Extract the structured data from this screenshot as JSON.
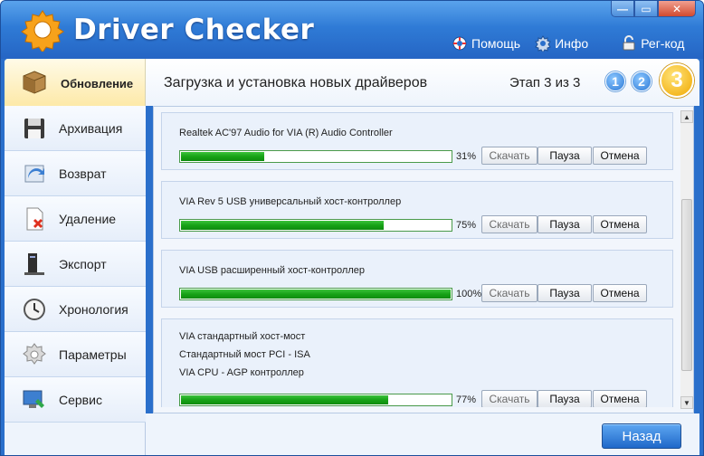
{
  "app": {
    "title": "Driver Checker"
  },
  "window_controls": {
    "minimize": "—",
    "restore": "▭",
    "close": "✕"
  },
  "top_links": [
    {
      "label": "Помощь",
      "icon": "help-icon"
    },
    {
      "label": "Инфо",
      "icon": "info-gear-icon"
    },
    {
      "label": "Рег-код",
      "icon": "lock-icon"
    }
  ],
  "header": {
    "active_tab": "Обновление",
    "title": "Загрузка и установка новых драйверов",
    "stage": "Этап 3 из 3",
    "steps": [
      "1",
      "2",
      "3"
    ]
  },
  "sidebar": {
    "items": [
      {
        "label": "Архивация",
        "icon": "floppy-disk-icon"
      },
      {
        "label": "Возврат",
        "icon": "restore-arrow-icon"
      },
      {
        "label": "Удаление",
        "icon": "delete-document-icon"
      },
      {
        "label": "Экспорт",
        "icon": "export-icon"
      },
      {
        "label": "Хронология",
        "icon": "clock-icon"
      },
      {
        "label": "Параметры",
        "icon": "settings-icon"
      },
      {
        "label": "Сервис",
        "icon": "service-monitor-icon"
      }
    ]
  },
  "buttons": {
    "download": "Скачать",
    "pause": "Пауза",
    "cancel": "Отмена"
  },
  "drivers": [
    {
      "names": [
        "Realtek AC'97 Audio for VIA (R) Audio Controller"
      ],
      "progress": 31,
      "progress_label": "31%"
    },
    {
      "names": [
        "VIA Rev 5 USB универсальный хост-контроллер"
      ],
      "progress": 75,
      "progress_label": "75%"
    },
    {
      "names": [
        "VIA USB расширенный хост-контроллер"
      ],
      "progress": 100,
      "progress_label": "100%"
    },
    {
      "names": [
        "VIA стандартный хост-мост",
        "Стандартный мост PCI - ISA",
        "VIA CPU - AGP контроллер"
      ],
      "progress": 77,
      "progress_label": "77%"
    }
  ],
  "footer": {
    "back": "Назад"
  },
  "colors": {
    "accent": "#2a6fcb",
    "progress": "#17a317",
    "active_tab": "#fde9a8"
  }
}
